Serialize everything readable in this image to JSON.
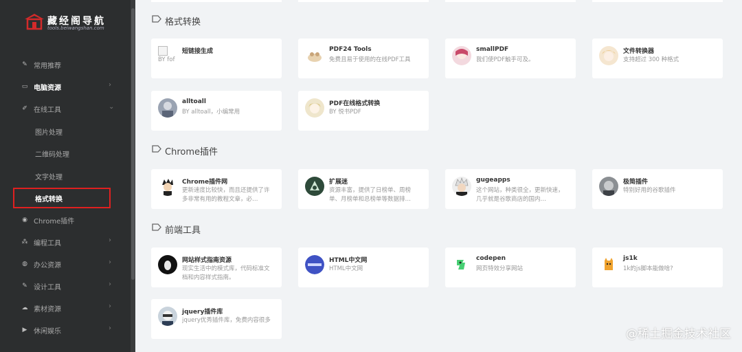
{
  "brand": {
    "title": "藏经阁导航",
    "subtitle": "tools.beiwangshan.com"
  },
  "nav": {
    "items": [
      {
        "label": "常用推荐",
        "icon": "pin-icon"
      },
      {
        "label": "电脑资源",
        "icon": "monitor-icon"
      },
      {
        "label": "在线工具",
        "icon": "wrench-icon"
      },
      {
        "label": "Chrome插件",
        "icon": "chrome-icon"
      },
      {
        "label": "编程工具",
        "icon": "code-icon"
      },
      {
        "label": "办公资源",
        "icon": "briefcase-icon"
      },
      {
        "label": "设计工具",
        "icon": "hammer-icon"
      },
      {
        "label": "素材资源",
        "icon": "cloud-icon"
      },
      {
        "label": "休闲娱乐",
        "icon": "play-icon"
      }
    ],
    "sub_items": [
      "图片处理",
      "二维码处理",
      "文字处理",
      "格式转换"
    ]
  },
  "sections": [
    {
      "title": "格式转换",
      "cards": [
        {
          "title": "短链接生成",
          "desc": "BY fof"
        },
        {
          "title": "PDF24 Tools",
          "desc": "免费且易于使用的在线PDF工具"
        },
        {
          "title": "smallPDF",
          "desc": "我们使PDF触手可及。"
        },
        {
          "title": "文件转换器",
          "desc": "支持超过 300 种格式"
        },
        {
          "title": "alltoall",
          "desc": "BY alltoall，小编常用"
        },
        {
          "title": "PDF在线格式转换",
          "desc": "BY 悦书PDF"
        }
      ]
    },
    {
      "title": "Chrome插件",
      "cards": [
        {
          "title": "Chrome插件网",
          "desc": "更新速度比较快，而且还提供了许多非常有用的教程文章，必…"
        },
        {
          "title": "扩展迷",
          "desc": "资源丰富，提供了日榜单、周榜单、月榜单和总榜单等数据排…"
        },
        {
          "title": "gugeapps",
          "desc": "这个网站，种类很全，更新快速，几乎就是谷歌商店的国内…"
        },
        {
          "title": "极简插件",
          "desc": "特别好用的谷歌插件"
        }
      ]
    },
    {
      "title": "前端工具",
      "cards": [
        {
          "title": "网站样式指南资源",
          "desc": "现实生活中的模式库，代码标准文档和内容样式指南。"
        },
        {
          "title": "HTML中文网",
          "desc": "HTML中文网"
        },
        {
          "title": "codepen",
          "desc": "网页特效分享网站"
        },
        {
          "title": "js1k",
          "desc": "1k的js脚本能做啥?"
        },
        {
          "title": "jquery插件库",
          "desc": "jquery优秀插件库，免费内容很多"
        }
      ]
    }
  ],
  "watermark": "@稀土掘金技术社区"
}
